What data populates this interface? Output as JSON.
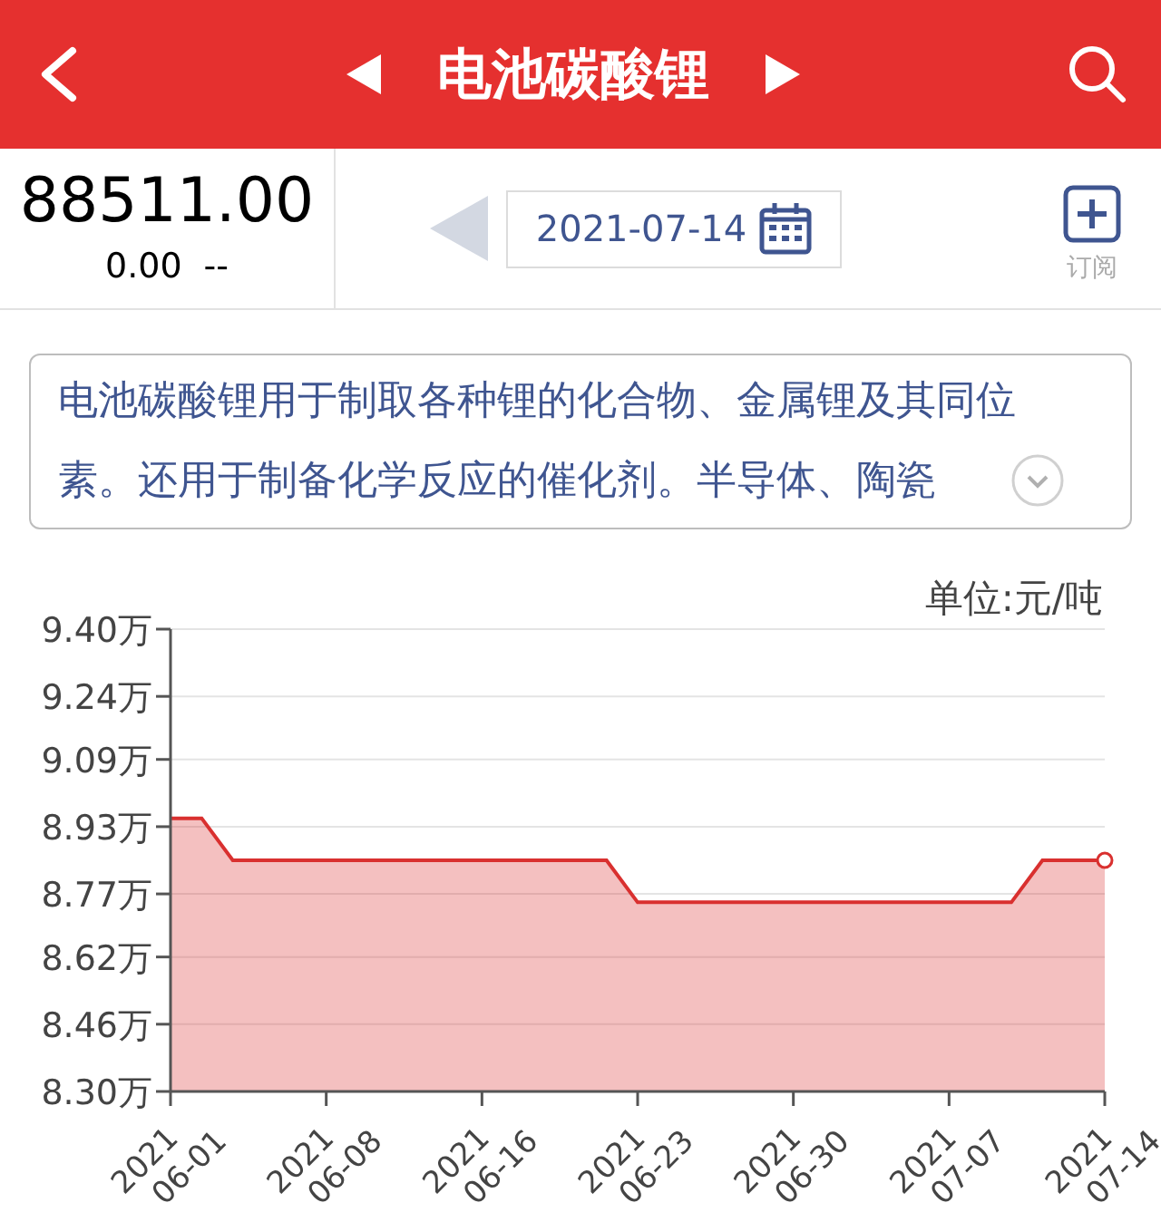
{
  "header": {
    "title": "电池碳酸锂"
  },
  "quote": {
    "price": "88511.00",
    "change": "0.00",
    "change_pct": "--"
  },
  "date_picker": {
    "value": "2021-07-14"
  },
  "subscribe": {
    "label": "订阅"
  },
  "description": {
    "text": "电池碳酸锂用于制取各种锂的化合物、金属锂及其同位素。还用于制备化学反应的催化剂。半导体、陶瓷",
    "expanded": false
  },
  "chart": {
    "unit": "单位:元/吨",
    "chart_data": {
      "type": "area",
      "categories": [
        "2021 06-01",
        null,
        null,
        null,
        null,
        "2021 06-08",
        null,
        null,
        null,
        null,
        "2021 06-16",
        null,
        null,
        null,
        null,
        "2021 06-23",
        null,
        null,
        null,
        null,
        "2021 06-30",
        null,
        null,
        null,
        null,
        "2021 07-07",
        null,
        null,
        null,
        null,
        "2021 07-14"
      ],
      "grid": true,
      "series": [
        {
          "color": "#d9302f",
          "values": [
            8.95,
            8.95,
            8.85,
            8.85,
            8.85,
            8.85,
            8.85,
            8.85,
            8.85,
            8.85,
            8.85,
            8.85,
            8.85,
            8.85,
            8.85,
            8.75,
            8.75,
            8.75,
            8.75,
            8.75,
            8.75,
            8.75,
            8.75,
            8.75,
            8.75,
            8.75,
            8.75,
            8.75,
            8.85,
            8.85,
            8.85
          ]
        }
      ],
      "ylim": [
        8.3,
        9.4
      ],
      "yticks": [
        {
          "value": 8.3,
          "label": "8.30万"
        },
        {
          "value": 8.46,
          "label": "8.46万"
        },
        {
          "value": 8.62,
          "label": "8.62万"
        },
        {
          "value": 8.77,
          "label": "8.77万"
        },
        {
          "value": 8.93,
          "label": "8.93万"
        },
        {
          "value": 9.09,
          "label": "9.09万"
        },
        {
          "value": 9.24,
          "label": "9.24万"
        },
        {
          "value": 9.4,
          "label": "9.40万"
        }
      ]
    }
  }
}
